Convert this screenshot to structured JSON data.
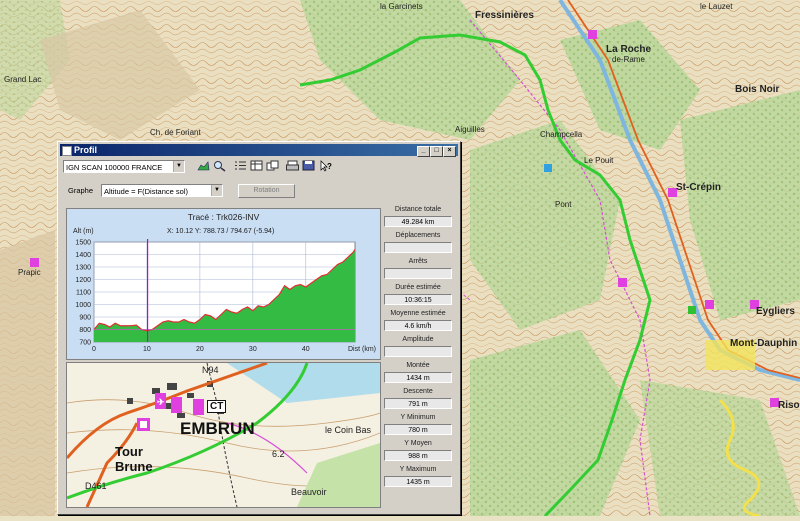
{
  "window": {
    "title": "Profil",
    "min_symbol": "_",
    "max_symbol": "□",
    "close_symbol": "×"
  },
  "toolbar": {
    "map_select": "IGN SCAN 100000 FRANCE",
    "icons": [
      "profile-icon",
      "zoom-icon",
      "list-icon",
      "grid-icon",
      "copy-icon",
      "print-icon",
      "help-icon"
    ]
  },
  "graph": {
    "label": "Graphe",
    "select": "Altitude = F(Distance sol)",
    "rotation_label": "Rotation"
  },
  "chart_data": {
    "type": "area",
    "title": "Tracé : Trk026-INV",
    "cursor_readout": "X: 10.12 Y: 788.73 / 794.67 (-5.94)",
    "ylabel": "Alt (m)",
    "xlabel": "Dist (km)",
    "xlim": [
      0,
      49.3
    ],
    "ylim": [
      700,
      1500
    ],
    "yticks": [
      700,
      800,
      900,
      1000,
      1100,
      1200,
      1300,
      1400,
      1500
    ],
    "xticks": [
      0,
      10,
      20,
      30,
      40
    ],
    "cursor_x": 10.12,
    "x": [
      0,
      1,
      2,
      3,
      4,
      5,
      6,
      7,
      8,
      9,
      10,
      11,
      12,
      13,
      14,
      15,
      16,
      17,
      18,
      19,
      20,
      21,
      22,
      23,
      24,
      25,
      26,
      27,
      28,
      29,
      30,
      31,
      32,
      33,
      34,
      35,
      36,
      37,
      38,
      39,
      40,
      41,
      42,
      43,
      44,
      45,
      46,
      47,
      48,
      49,
      49.28
    ],
    "y": [
      800,
      850,
      840,
      820,
      850,
      830,
      830,
      830,
      835,
      800,
      790,
      800,
      830,
      860,
      870,
      860,
      860,
      880,
      860,
      850,
      880,
      920,
      910,
      880,
      920,
      960,
      940,
      930,
      960,
      980,
      950,
      990,
      980,
      1000,
      1040,
      1080,
      1150,
      1120,
      1150,
      1160,
      1140,
      1170,
      1200,
      1230,
      1240,
      1280,
      1320,
      1340,
      1380,
      1420,
      1440
    ],
    "fill_color": "#33bb44",
    "line_color": "#e03030",
    "cursor_color": "#cc00cc",
    "base_line_color": "#c060c0"
  },
  "stats": [
    {
      "label": "Distance totale",
      "value": "49.284 km"
    },
    {
      "label": "Déplacements",
      "value": ""
    },
    {
      "label": "Arrêts",
      "value": ""
    },
    {
      "label": "Durée estimée",
      "value": "10:36:15"
    },
    {
      "label": "Moyenne estimée",
      "value": "4.6 km/h"
    },
    {
      "label": "Amplitude",
      "value": ""
    },
    {
      "label": "Montée",
      "value": "1434 m"
    },
    {
      "label": "Descente",
      "value": "791 m"
    },
    {
      "label": "Y Minimum",
      "value": "780 m"
    },
    {
      "label": "Y Moyen",
      "value": "988 m"
    },
    {
      "label": "Y Maximum",
      "value": "1435 m"
    }
  ],
  "minimap": {
    "town": "EMBRUN",
    "tower_1": "Tour",
    "tower_2": "Brune",
    "ct": "CT",
    "place_1": "le Coin Bas",
    "place_2": "Beauvoir",
    "road_1": "D461",
    "road_2": "N94",
    "number": "6.2"
  },
  "map_labels": {
    "fressinieres": "Fressinières",
    "la_roche": "La Roche",
    "de_rame": "de-Rame",
    "st_crepin": "St-Crépin",
    "bois_noir": "Bois Noir",
    "mont_dauphin": "Mont-Dauphin",
    "eygliers": "Eygliers",
    "risoul": "Risoul",
    "prapic": "Prapic",
    "champcella": "Champcella",
    "le_pouit": "Le Pouit",
    "pont": "Pont",
    "aiguilles": "Aiguilles",
    "la_garcinets": "la Garcinets",
    "le_lauzet": "le Lauzet",
    "ancelle": "Grand Lac",
    "ch_mini": "Ch. de Foriant"
  },
  "colors": {
    "track": "#33cc33",
    "road": "#e06020",
    "magenta": "#e040e0",
    "window_title": "#0a246a"
  }
}
